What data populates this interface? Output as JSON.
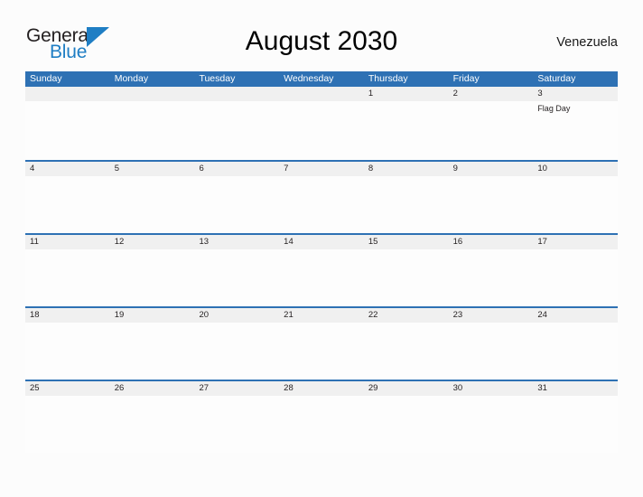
{
  "brand": {
    "name_part1": "General",
    "name_part2": "Blue",
    "flag_color": "#1f7ec4",
    "text_color": "#231f20"
  },
  "header": {
    "title": "August 2030",
    "region": "Venezuela"
  },
  "theme": {
    "header_blue": "#2e71b4",
    "row_band_gray": "#f0f0f0",
    "page_background": "#fcfcfc",
    "text_color": "#231f20"
  },
  "calendar": {
    "month": "August",
    "year": "2030",
    "weekday_headers": [
      "Sunday",
      "Monday",
      "Tuesday",
      "Wednesday",
      "Thursday",
      "Friday",
      "Saturday"
    ],
    "weeks": [
      [
        {
          "day": "",
          "events": []
        },
        {
          "day": "",
          "events": []
        },
        {
          "day": "",
          "events": []
        },
        {
          "day": "",
          "events": []
        },
        {
          "day": "1",
          "events": []
        },
        {
          "day": "2",
          "events": []
        },
        {
          "day": "3",
          "events": [
            "Flag Day"
          ]
        }
      ],
      [
        {
          "day": "4",
          "events": []
        },
        {
          "day": "5",
          "events": []
        },
        {
          "day": "6",
          "events": []
        },
        {
          "day": "7",
          "events": []
        },
        {
          "day": "8",
          "events": []
        },
        {
          "day": "9",
          "events": []
        },
        {
          "day": "10",
          "events": []
        }
      ],
      [
        {
          "day": "11",
          "events": []
        },
        {
          "day": "12",
          "events": []
        },
        {
          "day": "13",
          "events": []
        },
        {
          "day": "14",
          "events": []
        },
        {
          "day": "15",
          "events": []
        },
        {
          "day": "16",
          "events": []
        },
        {
          "day": "17",
          "events": []
        }
      ],
      [
        {
          "day": "18",
          "events": []
        },
        {
          "day": "19",
          "events": []
        },
        {
          "day": "20",
          "events": []
        },
        {
          "day": "21",
          "events": []
        },
        {
          "day": "22",
          "events": []
        },
        {
          "day": "23",
          "events": []
        },
        {
          "day": "24",
          "events": []
        }
      ],
      [
        {
          "day": "25",
          "events": []
        },
        {
          "day": "26",
          "events": []
        },
        {
          "day": "27",
          "events": []
        },
        {
          "day": "28",
          "events": []
        },
        {
          "day": "29",
          "events": []
        },
        {
          "day": "30",
          "events": []
        },
        {
          "day": "31",
          "events": []
        }
      ]
    ]
  }
}
